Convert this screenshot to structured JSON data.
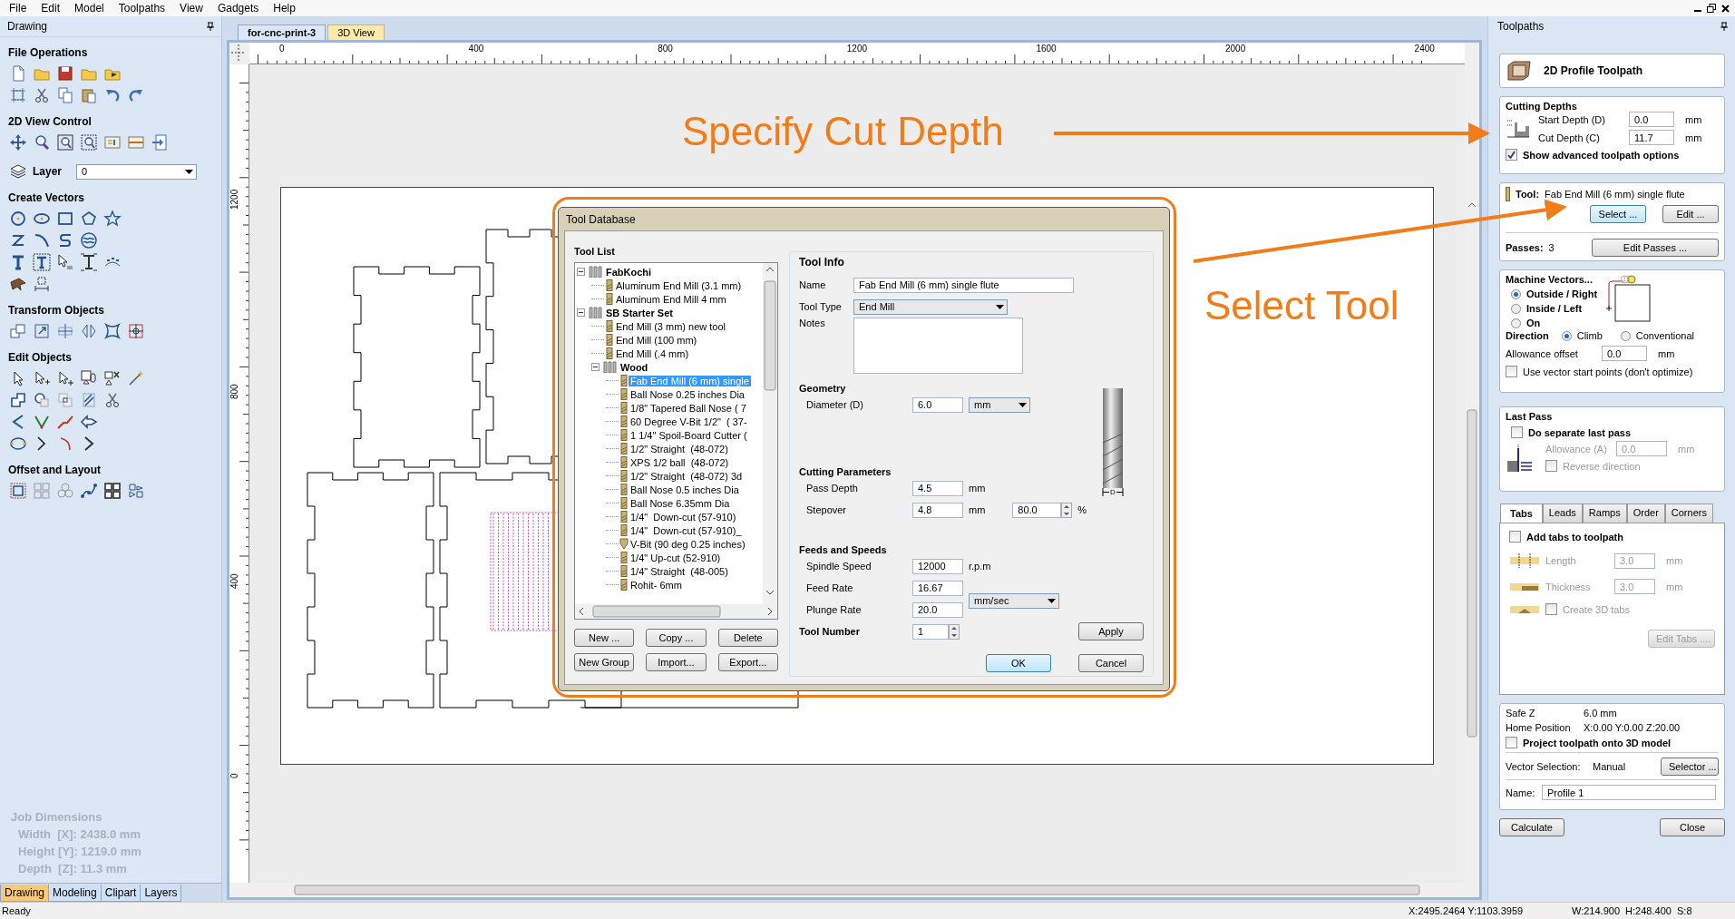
{
  "menu": [
    "File",
    "Edit",
    "Model",
    "Toolpaths",
    "View",
    "Gadgets",
    "Help"
  ],
  "drawing_panel": {
    "title": "Drawing",
    "sections": [
      {
        "kind": "tools",
        "title": "File Operations"
      },
      {
        "kind": "tools",
        "title": "2D View Control"
      },
      {
        "kind": "layer",
        "label": "Layer",
        "value": "0"
      },
      {
        "kind": "tools",
        "title": "Create Vectors"
      },
      {
        "kind": "tools",
        "title": "Transform Objects"
      },
      {
        "kind": "tools",
        "title": "Edit Objects"
      },
      {
        "kind": "tools",
        "title": "Offset and Layout"
      }
    ],
    "job_dimensions": {
      "title": "Job Dimensions",
      "lines": [
        "Width  [X]: 2438.0 mm",
        "Height [Y]: 1219.0 mm",
        "Depth  [Z]: 11.3 mm"
      ]
    },
    "tabs": [
      {
        "label": "Drawing",
        "selected": true
      },
      {
        "label": "Modeling",
        "selected": false
      },
      {
        "label": "Clipart",
        "selected": false
      },
      {
        "label": "Layers",
        "selected": false
      }
    ]
  },
  "document_tabs": [
    {
      "label": "for-cnc-print-3",
      "selected": true
    },
    {
      "label": "3D View",
      "selected": false
    }
  ],
  "ruler": {
    "x_labels": [
      "0",
      "400",
      "800",
      "1200",
      "1600",
      "2000",
      "2400"
    ],
    "y_labels": [
      "1200",
      "800",
      "400",
      "0"
    ]
  },
  "tool_database": {
    "title": "Tool Database",
    "tool_list_title": "Tool List",
    "tree": [
      {
        "label": "FabKochi",
        "kind": "group",
        "expanded": true,
        "children": [
          {
            "label": "Aluminum End Mill (3.1 mm)",
            "kind": "mill",
            "selected": false
          },
          {
            "label": "Aluminum End Mill 4 mm",
            "kind": "mill",
            "selected": false
          }
        ]
      },
      {
        "label": "SB Starter Set",
        "kind": "group",
        "expanded": true,
        "children": [
          {
            "label": "End Mill (3 mm) new tool",
            "kind": "mill",
            "selected": false
          },
          {
            "label": "End Mill (100 mm)",
            "kind": "mill",
            "selected": false
          },
          {
            "label": "End Mill (.4 mm)",
            "kind": "mill",
            "selected": false
          },
          {
            "label": "Wood",
            "kind": "group",
            "expanded": true,
            "children": [
              {
                "label": "Fab End Mill (6 mm) single",
                "kind": "mill",
                "selected": true
              },
              {
                "label": "Ball Nose 0.25 inches Dia",
                "kind": "mill",
                "selected": false
              },
              {
                "label": "1/8\" Tapered Ball Nose ( 7",
                "kind": "mill",
                "selected": false
              },
              {
                "label": "60 Degree V-Bit 1/2\"  ( 37-",
                "kind": "mill",
                "selected": false
              },
              {
                "label": "1 1/4\" Spoil-Board Cutter (",
                "kind": "mill",
                "selected": false
              },
              {
                "label": "1/2\" Straight  (48-072)",
                "kind": "mill",
                "selected": false
              },
              {
                "label": "XPS 1/2 ball  (48-072)",
                "kind": "mill",
                "selected": false
              },
              {
                "label": "1/2\" Straight  (48-072) 3d",
                "kind": "mill",
                "selected": false
              },
              {
                "label": "Ball Nose 0.5 inches Dia",
                "kind": "mill",
                "selected": false
              },
              {
                "label": "Ball Nose 6.35mm Dia",
                "kind": "mill",
                "selected": false
              },
              {
                "label": "1/4\"  Down-cut (57-910)",
                "kind": "mill",
                "selected": false
              },
              {
                "label": "1/4\"  Down-cut (57-910)_",
                "kind": "mill",
                "selected": false
              },
              {
                "label": "V-Bit (90 deg 0.25 inches)",
                "kind": "vbit",
                "selected": false
              },
              {
                "label": "1/4\" Up-cut (52-910)",
                "kind": "mill",
                "selected": false
              },
              {
                "label": "1/4\" Straight  (48-005)",
                "kind": "mill",
                "selected": false
              },
              {
                "label": "Rohit- 6mm",
                "kind": "mill",
                "selected": false
              }
            ]
          }
        ]
      }
    ],
    "list_buttons": [
      "New ...",
      "Copy ...",
      "Delete",
      "New Group",
      "Import...",
      "Export..."
    ],
    "tool_info": {
      "title": "Tool Info",
      "name_label": "Name",
      "name_value": "Fab End Mill (6 mm) single flute",
      "type_label": "Tool Type",
      "type_value": "End Mill",
      "notes_label": "Notes",
      "diagram_label": "D",
      "geometry": {
        "title": "Geometry",
        "diameter_label": "Diameter (D)",
        "diameter_value": "6.0",
        "diameter_unit": "mm"
      },
      "cutting": {
        "title": "Cutting Parameters",
        "pass_depth_label": "Pass Depth",
        "pass_depth_value": "4.5",
        "pass_depth_unit": "mm",
        "stepover_label": "Stepover",
        "stepover_value": "4.8",
        "stepover_unit": "mm",
        "stepover_percent": "80.0",
        "percent_sign": "%"
      },
      "feeds": {
        "title": "Feeds and Speeds",
        "spindle_label": "Spindle Speed",
        "spindle_value": "12000",
        "spindle_unit": "r.p.m",
        "feed_label": "Feed Rate",
        "feed_value": "16.67",
        "plunge_label": "Plunge Rate",
        "plunge_value": "20.0",
        "rate_unit": "mm/sec"
      },
      "tool_number_label": "Tool Number",
      "tool_number_value": "1",
      "apply": "Apply"
    },
    "buttons": [
      "OK",
      "Cancel"
    ]
  },
  "annotations": [
    {
      "text": "Specify Cut Depth"
    },
    {
      "text": "Select Tool"
    }
  ],
  "toolpaths_panel": {
    "title": "Toolpaths",
    "heading": "2D Profile Toolpath",
    "cutting_depths": {
      "title": "Cutting Depths",
      "start_label": "Start Depth (D)",
      "start_value": "0.0",
      "start_unit": "mm",
      "cut_label": "Cut Depth (C)",
      "cut_value": "11.7",
      "cut_unit": "mm",
      "advanced": {
        "label": "Show advanced toolpath options",
        "checked": true
      }
    },
    "tool": {
      "label": "Tool:",
      "value": "Fab End Mill (6 mm) single flute",
      "select": "Select ...",
      "edit": "Edit ..."
    },
    "passes": {
      "label": "Passes:",
      "value": "3",
      "button": "Edit Passes ..."
    },
    "machine_vectors": {
      "title": "Machine Vectors...",
      "options": [
        {
          "label": "Outside / Right",
          "selected": true
        },
        {
          "label": "Inside / Left",
          "selected": false
        },
        {
          "label": "On",
          "selected": false
        }
      ],
      "direction_label": "Direction",
      "directions": [
        {
          "label": "Climb",
          "selected": true
        },
        {
          "label": "Conventional",
          "selected": false
        }
      ],
      "allowance_label": "Allowance offset",
      "allowance_value": "0.0",
      "allowance_unit": "mm",
      "start_points": {
        "label": "Use vector start points (don't optimize)",
        "checked": false
      }
    },
    "last_pass": {
      "title": "Last Pass",
      "separate": {
        "label": "Do separate last pass",
        "checked": false
      },
      "disabled": true,
      "allowance_label": "Allowance (A)",
      "allowance_value": "0.0",
      "allowance_unit": "mm",
      "reverse": {
        "label": "Reverse direction",
        "checked": false
      }
    },
    "tabs": [
      {
        "label": "Tabs",
        "selected": true
      },
      {
        "label": "Leads",
        "selected": false
      },
      {
        "label": "Ramps",
        "selected": false
      },
      {
        "label": "Order",
        "selected": false
      },
      {
        "label": "Corners",
        "selected": false
      }
    ],
    "tabs_page": {
      "add": {
        "label": "Add tabs to toolpath",
        "checked": false
      },
      "disabled": true,
      "length_label": "Length",
      "length_value": "3.0",
      "length_unit": "mm",
      "thickness_label": "Thickness",
      "thickness_value": "3.0",
      "thickness_unit": "mm",
      "create3d": {
        "label": "Create 3D tabs",
        "checked": false
      },
      "edit_button": "Edit Tabs ...."
    },
    "safe_z_label": "Safe Z",
    "safe_z_value": "6.0 mm",
    "home_label": "Home Position",
    "home_value": "X:0.00 Y:0.00 Z:20.00",
    "project": {
      "label": "Project toolpath onto 3D model",
      "checked": false
    },
    "selection_label": "Vector Selection:",
    "selection_value": "Manual",
    "selector_button": "Selector ...",
    "name_label": "Name:",
    "name_value": "Profile 1",
    "buttons": [
      "Calculate",
      "Close"
    ]
  },
  "status_bar": {
    "message": "Ready",
    "cursor": "X:2495.2464 Y:1103.3959",
    "size": "W:214.900  H:248.400  S:8"
  }
}
